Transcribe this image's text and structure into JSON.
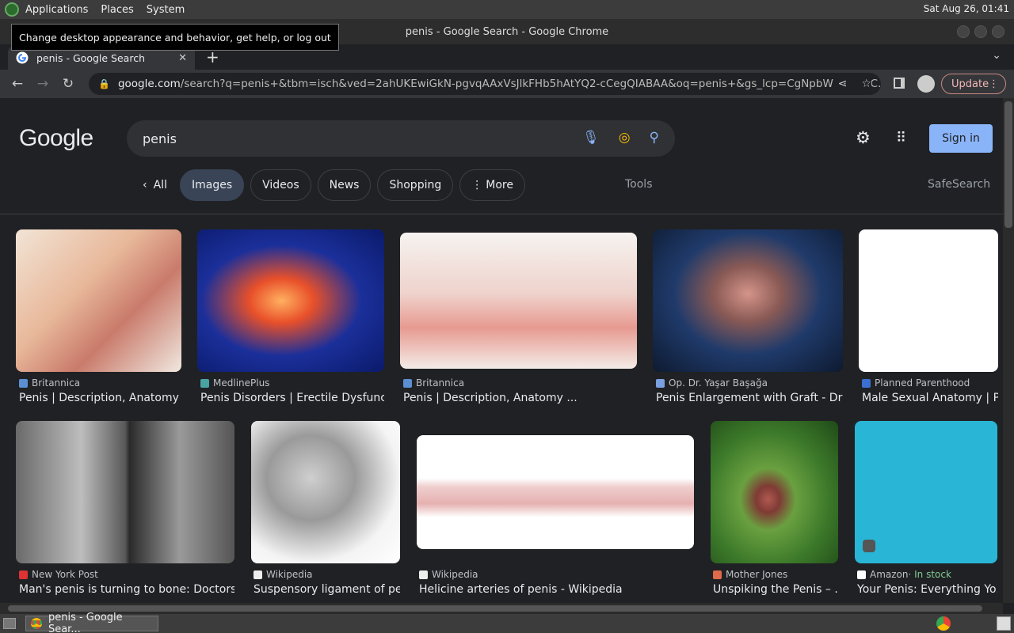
{
  "panel": {
    "menus": [
      "Applications",
      "Places",
      "System"
    ],
    "clock": "Sat Aug 26, 01:41",
    "tooltip": "Change desktop appearance and behavior, get help, or log out"
  },
  "window": {
    "title": "penis - Google Search - Google Chrome"
  },
  "tab": {
    "title": "penis - Google Search",
    "close": "✕"
  },
  "toolbar": {
    "url_host": "google.com",
    "url_path": "/search?q=penis+&tbm=isch&ved=2ahUKEwiGkN-pgvqAAxVsJlkFHb5hAtYQ2-cCegQIABAA&oq=penis+&gs_lcp=CgNpbWcQAzIEC...",
    "update_label": "Update"
  },
  "google": {
    "logo": "Google",
    "query": "penis",
    "sign_in": "Sign in",
    "chips": {
      "all": "All",
      "images": "Images",
      "videos": "Videos",
      "news": "News",
      "shopping": "Shopping",
      "more": "More"
    },
    "tools": "Tools",
    "safesearch": "SafeSearch"
  },
  "results": [
    {
      "source": "Britannica",
      "title": "Penis | Description, Anatomy ...",
      "icon_color": "#5b8fd1"
    },
    {
      "source": "MedlinePlus",
      "title": "Penis Disorders | Erectile Dysfunc...",
      "icon_color": "#4aa3a3"
    },
    {
      "source": "Britannica",
      "title": "Penis | Description, Anatomy ...",
      "icon_color": "#5b8fd1"
    },
    {
      "source": "Op. Dr. Yaşar Başağa",
      "title": "Penis Enlargement with Graft - Dr ...",
      "icon_color": "#7aa0e0"
    },
    {
      "source": "Planned Parenthood",
      "title": "Male Sexual Anatomy | P...",
      "icon_color": "#3b6fd0"
    },
    {
      "source": "New York Post",
      "title": "Man's penis is turning to bone: Doctors ...",
      "icon_color": "#d33"
    },
    {
      "source": "Wikipedia",
      "title": "Suspensory ligament of pe...",
      "icon_color": "#eee"
    },
    {
      "source": "Wikipedia",
      "title": "Helicine arteries of penis - Wikipedia",
      "icon_color": "#eee"
    },
    {
      "source": "Mother Jones",
      "title": "Unspiking the Penis – ...",
      "icon_color": "#e06b4a"
    },
    {
      "source": "Amazon",
      "stock": " · In stock",
      "title": "Your Penis: Everything Yo...",
      "icon_color": "#fff"
    }
  ],
  "taskbar": {
    "item": "penis - Google Sear..."
  }
}
